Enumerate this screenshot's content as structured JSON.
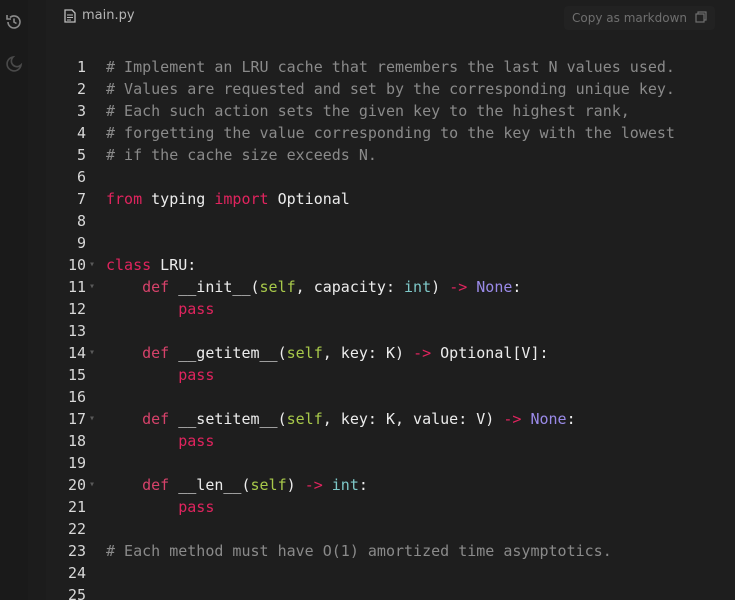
{
  "file_tab": {
    "name": "main.py",
    "icon": "file-icon"
  },
  "copy_button": {
    "label": "Copy as markdown",
    "icon": "copy-icon"
  },
  "rail": {
    "icons": [
      "history-icon",
      "moon-icon"
    ]
  },
  "code": {
    "lines": [
      {
        "n": "1",
        "fold": false,
        "tokens": [
          {
            "t": "# Implement an LRU cache that remembers the last N values used.",
            "c": "comment"
          }
        ]
      },
      {
        "n": "2",
        "fold": false,
        "tokens": [
          {
            "t": "# Values are requested and set by the corresponding unique key.",
            "c": "comment"
          }
        ]
      },
      {
        "n": "3",
        "fold": false,
        "tokens": [
          {
            "t": "# Each such action sets the given key to the highest rank,",
            "c": "comment"
          }
        ]
      },
      {
        "n": "4",
        "fold": false,
        "tokens": [
          {
            "t": "# forgetting the value corresponding to the key with the lowest",
            "c": "comment"
          }
        ]
      },
      {
        "n": "5",
        "fold": false,
        "tokens": [
          {
            "t": "# if the cache size exceeds N.",
            "c": "comment"
          }
        ]
      },
      {
        "n": "6",
        "fold": false,
        "tokens": []
      },
      {
        "n": "7",
        "fold": false,
        "tokens": [
          {
            "t": "from",
            "c": "kw"
          },
          {
            "t": " typing ",
            "c": "plain"
          },
          {
            "t": "import",
            "c": "kw"
          },
          {
            "t": " Optional",
            "c": "plain"
          }
        ]
      },
      {
        "n": "8",
        "fold": false,
        "tokens": []
      },
      {
        "n": "9",
        "fold": false,
        "tokens": []
      },
      {
        "n": "10",
        "fold": true,
        "tokens": [
          {
            "t": "class",
            "c": "kw"
          },
          {
            "t": " LRU:",
            "c": "plain"
          }
        ]
      },
      {
        "n": "11",
        "fold": true,
        "tokens": [
          {
            "t": "    ",
            "c": "plain"
          },
          {
            "t": "def",
            "c": "def"
          },
          {
            "t": " __init__(",
            "c": "plain"
          },
          {
            "t": "self",
            "c": "self"
          },
          {
            "t": ", capacity: ",
            "c": "plain"
          },
          {
            "t": "int",
            "c": "type"
          },
          {
            "t": ") ",
            "c": "plain"
          },
          {
            "t": "->",
            "c": "arrow"
          },
          {
            "t": " ",
            "c": "plain"
          },
          {
            "t": "None",
            "c": "none"
          },
          {
            "t": ":",
            "c": "plain"
          }
        ]
      },
      {
        "n": "12",
        "fold": false,
        "tokens": [
          {
            "t": "        ",
            "c": "plain"
          },
          {
            "t": "pass",
            "c": "kw"
          }
        ]
      },
      {
        "n": "13",
        "fold": false,
        "tokens": []
      },
      {
        "n": "14",
        "fold": true,
        "tokens": [
          {
            "t": "    ",
            "c": "plain"
          },
          {
            "t": "def",
            "c": "def"
          },
          {
            "t": " __getitem__(",
            "c": "plain"
          },
          {
            "t": "self",
            "c": "self"
          },
          {
            "t": ", key: K) ",
            "c": "plain"
          },
          {
            "t": "->",
            "c": "arrow"
          },
          {
            "t": " Optional[V]:",
            "c": "plain"
          }
        ]
      },
      {
        "n": "15",
        "fold": false,
        "tokens": [
          {
            "t": "        ",
            "c": "plain"
          },
          {
            "t": "pass",
            "c": "kw"
          }
        ]
      },
      {
        "n": "16",
        "fold": false,
        "tokens": []
      },
      {
        "n": "17",
        "fold": true,
        "tokens": [
          {
            "t": "    ",
            "c": "plain"
          },
          {
            "t": "def",
            "c": "def"
          },
          {
            "t": " __setitem__(",
            "c": "plain"
          },
          {
            "t": "self",
            "c": "self"
          },
          {
            "t": ", key: K, value: V) ",
            "c": "plain"
          },
          {
            "t": "->",
            "c": "arrow"
          },
          {
            "t": " ",
            "c": "plain"
          },
          {
            "t": "None",
            "c": "none"
          },
          {
            "t": ":",
            "c": "plain"
          }
        ]
      },
      {
        "n": "18",
        "fold": false,
        "tokens": [
          {
            "t": "        ",
            "c": "plain"
          },
          {
            "t": "pass",
            "c": "kw"
          }
        ]
      },
      {
        "n": "19",
        "fold": false,
        "tokens": []
      },
      {
        "n": "20",
        "fold": true,
        "tokens": [
          {
            "t": "    ",
            "c": "plain"
          },
          {
            "t": "def",
            "c": "def"
          },
          {
            "t": " __len__(",
            "c": "plain"
          },
          {
            "t": "self",
            "c": "self"
          },
          {
            "t": ") ",
            "c": "plain"
          },
          {
            "t": "->",
            "c": "arrow"
          },
          {
            "t": " ",
            "c": "plain"
          },
          {
            "t": "int",
            "c": "type"
          },
          {
            "t": ":",
            "c": "plain"
          }
        ]
      },
      {
        "n": "21",
        "fold": false,
        "tokens": [
          {
            "t": "        ",
            "c": "plain"
          },
          {
            "t": "pass",
            "c": "kw"
          }
        ]
      },
      {
        "n": "22",
        "fold": false,
        "tokens": []
      },
      {
        "n": "23",
        "fold": false,
        "tokens": [
          {
            "t": "# Each method must have O(1) amortized time asymptotics.",
            "c": "comment"
          }
        ]
      },
      {
        "n": "24",
        "fold": false,
        "tokens": []
      },
      {
        "n": "25",
        "fold": false,
        "tokens": []
      }
    ]
  }
}
